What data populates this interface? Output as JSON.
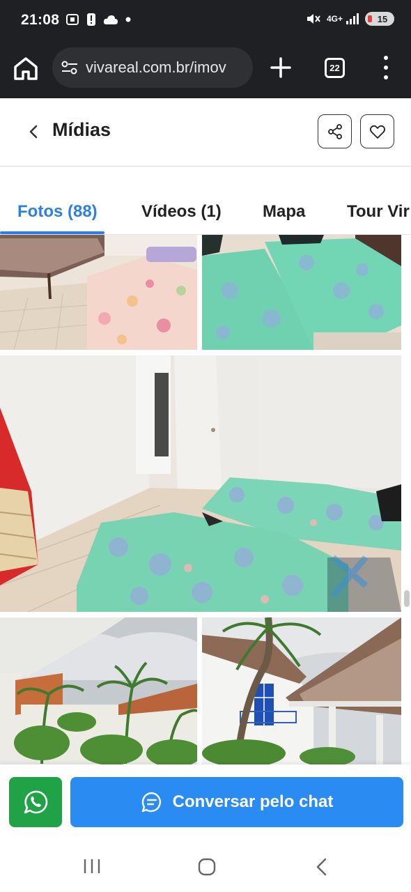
{
  "status_bar": {
    "time": "21:08",
    "network": "4G+",
    "battery": "15"
  },
  "browser": {
    "url": "vivareal.com.br/imov",
    "tab_count": "22"
  },
  "header": {
    "title": "Mídias"
  },
  "tabs": [
    {
      "label": "Fotos (88)",
      "active": true
    },
    {
      "label": "Vídeos (1)",
      "active": false
    },
    {
      "label": "Mapa",
      "active": false
    },
    {
      "label": "Tour Vir",
      "active": false
    }
  ],
  "gallery": {
    "photos": [
      {
        "icon": "bedroom-photo"
      },
      {
        "icon": "twin-beds-photo"
      },
      {
        "icon": "room-two-beds-photo"
      },
      {
        "icon": "palm-trees-photo"
      },
      {
        "icon": "house-exterior-photo"
      }
    ]
  },
  "actions": {
    "chat_label": "Conversar pelo chat",
    "whatsapp_icon": "whatsapp-icon"
  },
  "colors": {
    "accent": "#2d7fe0",
    "chat_button": "#2a8bf2",
    "whatsapp_button": "#20a346",
    "browser_bar": "#1f2023"
  }
}
